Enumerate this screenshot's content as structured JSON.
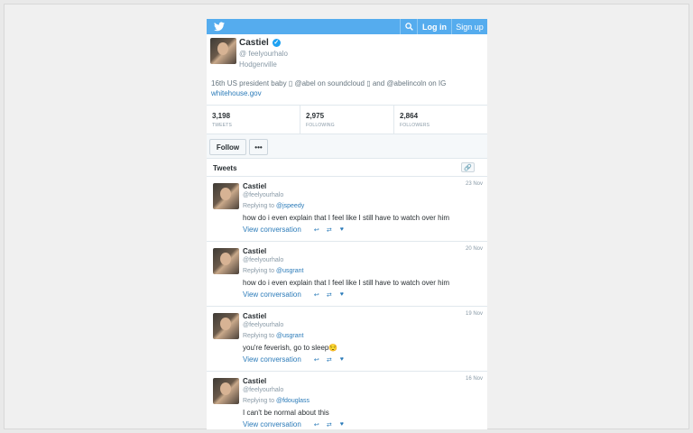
{
  "topbar": {
    "login_label": "Log in",
    "signup_label": "Sign up",
    "accent": "#55acee"
  },
  "profile": {
    "name": "Castiel",
    "verified_glyph": "✓",
    "handle_prefix": "@",
    "handle": "feelyourhalo",
    "location": "Hodgenville",
    "bio_text": "16th US president baby ▯ @abel on soundcloud ▯ and @abelincoln on IG",
    "bio_link": "whitehouse.gov"
  },
  "stats": [
    {
      "value": "3,198",
      "label": "TWEETS"
    },
    {
      "value": "2,975",
      "label": "FOLLOWING"
    },
    {
      "value": "2,864",
      "label": "FOLLOWERS"
    }
  ],
  "actions": {
    "follow_label": "Follow",
    "more_label": "•••"
  },
  "tweets_header": {
    "title": "Tweets",
    "link_glyph": "🔗"
  },
  "tweets": [
    {
      "name": "Castiel",
      "handle": "@feelyourhalo",
      "date": "23 Nov",
      "replying_prefix": "Replying to",
      "replying_to": "@jspeedy",
      "text": "how do i even explain that I feel like I still have to watch over him",
      "conversation": "View conversation"
    },
    {
      "name": "Castiel",
      "handle": "@feelyourhalo",
      "date": "20 Nov",
      "replying_prefix": "Replying to",
      "replying_to": "@usgrant",
      "text": "how do i even explain that I feel like I still have to watch over him",
      "conversation": "View conversation"
    },
    {
      "name": "Castiel",
      "handle": "@feelyourhalo",
      "date": "19 Nov",
      "replying_prefix": "Replying to",
      "replying_to": "@usgrant",
      "text": "you're feverish, go to sleep😌",
      "conversation": "View conversation"
    },
    {
      "name": "Castiel",
      "handle": "@feelyourhalo",
      "date": "16 Nov",
      "replying_prefix": "Replying to",
      "replying_to": "@fdouglass",
      "text": "I can't be normal about this",
      "conversation": "View conversation"
    }
  ],
  "tweet_actions": {
    "reply_glyph": "↩",
    "retweet_glyph": "⇄",
    "like_glyph": "♥"
  }
}
